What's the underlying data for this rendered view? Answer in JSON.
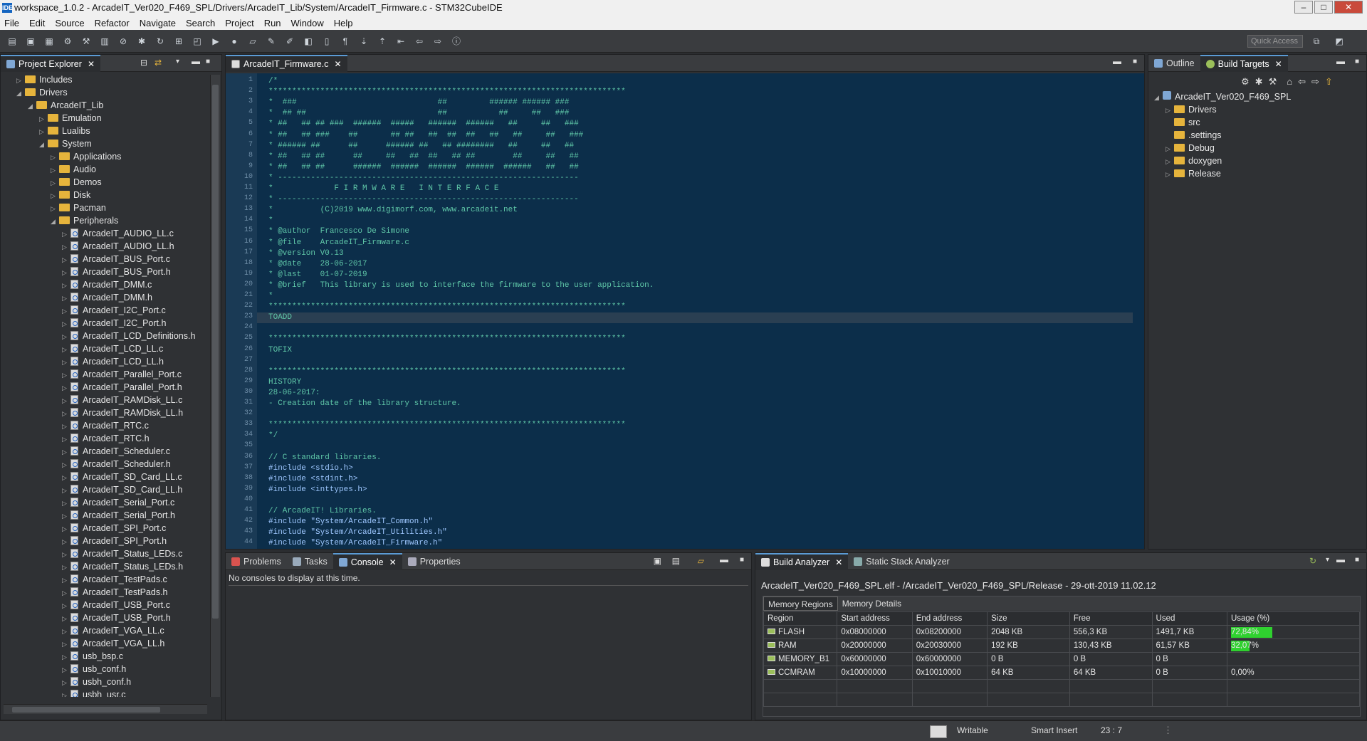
{
  "window": {
    "title": "workspace_1.0.2 - ArcadeIT_Ver020_F469_SPL/Drivers/ArcadeIT_Lib/System/ArcadeIT_Firmware.c - STM32CubeIDE",
    "logo": "IDE"
  },
  "menu": [
    "File",
    "Edit",
    "Source",
    "Refactor",
    "Navigate",
    "Search",
    "Project",
    "Run",
    "Window",
    "Help"
  ],
  "toolbar": {
    "quick_access_placeholder": "Quick Access"
  },
  "explorer": {
    "tab_label": "Project Explorer",
    "tree": [
      {
        "label": "Includes",
        "level": 1,
        "type": "folder",
        "arrow": "▷"
      },
      {
        "label": "Drivers",
        "level": 1,
        "type": "folder",
        "arrow": "◢"
      },
      {
        "label": "ArcadeIT_Lib",
        "level": 2,
        "type": "folder",
        "arrow": "◢"
      },
      {
        "label": "Emulation",
        "level": 3,
        "type": "folder",
        "arrow": "▷"
      },
      {
        "label": "Lualibs",
        "level": 3,
        "type": "folder",
        "arrow": "▷"
      },
      {
        "label": "System",
        "level": 3,
        "type": "folder",
        "arrow": "◢"
      },
      {
        "label": "Applications",
        "level": 4,
        "type": "folder",
        "arrow": "▷"
      },
      {
        "label": "Audio",
        "level": 4,
        "type": "folder",
        "arrow": "▷"
      },
      {
        "label": "Demos",
        "level": 4,
        "type": "folder",
        "arrow": "▷"
      },
      {
        "label": "Disk",
        "level": 4,
        "type": "folder",
        "arrow": "▷"
      },
      {
        "label": "Pacman",
        "level": 4,
        "type": "folder",
        "arrow": "▷"
      },
      {
        "label": "Peripherals",
        "level": 4,
        "type": "folder",
        "arrow": "◢"
      },
      {
        "label": "ArcadeIT_AUDIO_LL.c",
        "level": 5,
        "type": "file",
        "arrow": "▷"
      },
      {
        "label": "ArcadeIT_AUDIO_LL.h",
        "level": 5,
        "type": "file",
        "arrow": "▷"
      },
      {
        "label": "ArcadeIT_BUS_Port.c",
        "level": 5,
        "type": "file",
        "arrow": "▷"
      },
      {
        "label": "ArcadeIT_BUS_Port.h",
        "level": 5,
        "type": "file",
        "arrow": "▷"
      },
      {
        "label": "ArcadeIT_DMM.c",
        "level": 5,
        "type": "file",
        "arrow": "▷"
      },
      {
        "label": "ArcadeIT_DMM.h",
        "level": 5,
        "type": "file",
        "arrow": "▷"
      },
      {
        "label": "ArcadeIT_I2C_Port.c",
        "level": 5,
        "type": "file",
        "arrow": "▷"
      },
      {
        "label": "ArcadeIT_I2C_Port.h",
        "level": 5,
        "type": "file",
        "arrow": "▷"
      },
      {
        "label": "ArcadeIT_LCD_Definitions.h",
        "level": 5,
        "type": "file",
        "arrow": "▷"
      },
      {
        "label": "ArcadeIT_LCD_LL.c",
        "level": 5,
        "type": "file",
        "arrow": "▷"
      },
      {
        "label": "ArcadeIT_LCD_LL.h",
        "level": 5,
        "type": "file",
        "arrow": "▷"
      },
      {
        "label": "ArcadeIT_Parallel_Port.c",
        "level": 5,
        "type": "file",
        "arrow": "▷"
      },
      {
        "label": "ArcadeIT_Parallel_Port.h",
        "level": 5,
        "type": "file",
        "arrow": "▷"
      },
      {
        "label": "ArcadeIT_RAMDisk_LL.c",
        "level": 5,
        "type": "file",
        "arrow": "▷"
      },
      {
        "label": "ArcadeIT_RAMDisk_LL.h",
        "level": 5,
        "type": "file",
        "arrow": "▷"
      },
      {
        "label": "ArcadeIT_RTC.c",
        "level": 5,
        "type": "file",
        "arrow": "▷"
      },
      {
        "label": "ArcadeIT_RTC.h",
        "level": 5,
        "type": "file",
        "arrow": "▷"
      },
      {
        "label": "ArcadeIT_Scheduler.c",
        "level": 5,
        "type": "file",
        "arrow": "▷"
      },
      {
        "label": "ArcadeIT_Scheduler.h",
        "level": 5,
        "type": "file",
        "arrow": "▷"
      },
      {
        "label": "ArcadeIT_SD_Card_LL.c",
        "level": 5,
        "type": "file",
        "arrow": "▷"
      },
      {
        "label": "ArcadeIT_SD_Card_LL.h",
        "level": 5,
        "type": "file",
        "arrow": "▷"
      },
      {
        "label": "ArcadeIT_Serial_Port.c",
        "level": 5,
        "type": "file",
        "arrow": "▷"
      },
      {
        "label": "ArcadeIT_Serial_Port.h",
        "level": 5,
        "type": "file",
        "arrow": "▷"
      },
      {
        "label": "ArcadeIT_SPI_Port.c",
        "level": 5,
        "type": "file",
        "arrow": "▷"
      },
      {
        "label": "ArcadeIT_SPI_Port.h",
        "level": 5,
        "type": "file",
        "arrow": "▷"
      },
      {
        "label": "ArcadeIT_Status_LEDs.c",
        "level": 5,
        "type": "file",
        "arrow": "▷"
      },
      {
        "label": "ArcadeIT_Status_LEDs.h",
        "level": 5,
        "type": "file",
        "arrow": "▷"
      },
      {
        "label": "ArcadeIT_TestPads.c",
        "level": 5,
        "type": "file",
        "arrow": "▷"
      },
      {
        "label": "ArcadeIT_TestPads.h",
        "level": 5,
        "type": "file",
        "arrow": "▷"
      },
      {
        "label": "ArcadeIT_USB_Port.c",
        "level": 5,
        "type": "file",
        "arrow": "▷"
      },
      {
        "label": "ArcadeIT_USB_Port.h",
        "level": 5,
        "type": "file",
        "arrow": "▷"
      },
      {
        "label": "ArcadeIT_VGA_LL.c",
        "level": 5,
        "type": "file",
        "arrow": "▷"
      },
      {
        "label": "ArcadeIT_VGA_LL.h",
        "level": 5,
        "type": "file",
        "arrow": "▷"
      },
      {
        "label": "usb_bsp.c",
        "level": 5,
        "type": "file",
        "arrow": "▷"
      },
      {
        "label": "usb_conf.h",
        "level": 5,
        "type": "file",
        "arrow": "▷"
      },
      {
        "label": "usbh_conf.h",
        "level": 5,
        "type": "file",
        "arrow": "▷"
      },
      {
        "label": "usbh_usr.c",
        "level": 5,
        "type": "file",
        "arrow": "▷"
      }
    ]
  },
  "editor": {
    "tab_label": "ArcadeIT_Firmware.c",
    "current_line": 23,
    "lines": [
      {
        "n": "1",
        "t": "/*",
        "k": "cm"
      },
      {
        "n": "2",
        "t": "****************************************************************************",
        "k": "cm"
      },
      {
        "n": "3",
        "t": "*  ###                              ##         ###### ###### ###",
        "k": "cm"
      },
      {
        "n": "4",
        "t": "*  ## ##                            ##           ##     ##   ###",
        "k": "cm"
      },
      {
        "n": "5",
        "t": "* ##   ## ## ###  ######  #####   ######  ######   ##     ##   ###",
        "k": "cm"
      },
      {
        "n": "6",
        "t": "* ##   ## ###    ##       ## ##   ##  ##  ##   ##   ##     ##   ###",
        "k": "cm"
      },
      {
        "n": "7",
        "t": "* ###### ##      ##      ###### ##   ## ########   ##     ##   ##",
        "k": "cm"
      },
      {
        "n": "8",
        "t": "* ##   ## ##      ##     ##   ##  ##   ## ##        ##     ##   ##",
        "k": "cm"
      },
      {
        "n": "9",
        "t": "* ##   ## ##      ######  ######  ######  ######  ######   ##   ##",
        "k": "cm"
      },
      {
        "n": "10",
        "t": "* ----------------------------------------------------------------",
        "k": "cm"
      },
      {
        "n": "11",
        "t": "*             F I R M W A R E   I N T E R F A C E",
        "k": "cm"
      },
      {
        "n": "12",
        "t": "* ----------------------------------------------------------------",
        "k": "cm"
      },
      {
        "n": "13",
        "t": "*          (C)2019 www.digimorf.com, www.arcadeit.net",
        "k": "cm"
      },
      {
        "n": "14",
        "t": "*",
        "k": "cm"
      },
      {
        "n": "15",
        "t": "* @author  Francesco De Simone",
        "k": "cm"
      },
      {
        "n": "16",
        "t": "* @file    ArcadeIT_Firmware.c",
        "k": "cm"
      },
      {
        "n": "17",
        "t": "* @version V0.13",
        "k": "cm"
      },
      {
        "n": "18",
        "t": "* @date    28-06-2017",
        "k": "cm"
      },
      {
        "n": "19",
        "t": "* @last    01-07-2019",
        "k": "cm"
      },
      {
        "n": "20",
        "t": "* @brief   This library is used to interface the firmware to the user application.",
        "k": "cm"
      },
      {
        "n": "21",
        "t": "*",
        "k": "cm"
      },
      {
        "n": "22",
        "t": "****************************************************************************",
        "k": "cm"
      },
      {
        "n": "23",
        "t": "TOADD",
        "k": "cm"
      },
      {
        "n": "24",
        "t": "",
        "k": "cm"
      },
      {
        "n": "25",
        "t": "****************************************************************************",
        "k": "cm"
      },
      {
        "n": "26",
        "t": "TOFIX",
        "k": "cm"
      },
      {
        "n": "27",
        "t": "",
        "k": "cm"
      },
      {
        "n": "28",
        "t": "****************************************************************************",
        "k": "cm"
      },
      {
        "n": "29",
        "t": "HISTORY",
        "k": "cm"
      },
      {
        "n": "30",
        "t": "28-06-2017:",
        "k": "cm"
      },
      {
        "n": "31",
        "t": "- Creation date of the library structure.",
        "k": "cm"
      },
      {
        "n": "32",
        "t": "",
        "k": "cm"
      },
      {
        "n": "33",
        "t": "****************************************************************************",
        "k": "cm"
      },
      {
        "n": "34",
        "t": "*/",
        "k": "cm"
      },
      {
        "n": "35",
        "t": "",
        "k": "cm"
      },
      {
        "n": "36",
        "t": "// C standard libraries.",
        "k": "cm"
      },
      {
        "n": "37",
        "t": "#include <stdio.h>",
        "k": "inc"
      },
      {
        "n": "38",
        "t": "#include <stdint.h>",
        "k": "inc"
      },
      {
        "n": "39",
        "t": "#include <inttypes.h>",
        "k": "inc"
      },
      {
        "n": "40",
        "t": "",
        "k": "cm"
      },
      {
        "n": "41",
        "t": "// ArcadeIT! Libraries.",
        "k": "cm"
      },
      {
        "n": "42",
        "t": "#include \"System/ArcadeIT_Common.h\"",
        "k": "inc"
      },
      {
        "n": "43",
        "t": "#include \"System/ArcadeIT_Utilities.h\"",
        "k": "inc"
      },
      {
        "n": "44",
        "t": "#include \"System/ArcadeIT_Firmware.h\"",
        "k": "inc"
      }
    ]
  },
  "outline": {
    "tabs": [
      "Outline",
      "Build Targets"
    ],
    "tree": [
      {
        "label": "ArcadeIT_Ver020_F469_SPL",
        "level": 1,
        "arrow": "◢"
      },
      {
        "label": "Drivers",
        "level": 2,
        "arrow": "▷"
      },
      {
        "label": "src",
        "level": 2,
        "arrow": ""
      },
      {
        "label": ".settings",
        "level": 2,
        "arrow": ""
      },
      {
        "label": "Debug",
        "level": 2,
        "arrow": "▷"
      },
      {
        "label": "doxygen",
        "level": 2,
        "arrow": "▷"
      },
      {
        "label": "Release",
        "level": 2,
        "arrow": "▷"
      }
    ]
  },
  "console": {
    "tabs": [
      "Problems",
      "Tasks",
      "Console",
      "Properties"
    ],
    "message": "No consoles to display at this time."
  },
  "analyzer": {
    "tabs": [
      "Build Analyzer",
      "Static Stack Analyzer"
    ],
    "header": "ArcadeIT_Ver020_F469_SPL.elf - /ArcadeIT_Ver020_F469_SPL/Release - 29-ott-2019 11.02.12",
    "subtabs": [
      "Memory Regions",
      "Memory Details"
    ],
    "columns": [
      "Region",
      "Start address",
      "End address",
      "Size",
      "Free",
      "Used",
      "Usage (%)"
    ],
    "rows": [
      {
        "region": "FLASH",
        "start": "0x08000000",
        "end": "0x08200000",
        "size": "2048 KB",
        "free": "556,3 KB",
        "used": "1491,7 KB",
        "usage": "72,84%",
        "pct": 72.84
      },
      {
        "region": "RAM",
        "start": "0x20000000",
        "end": "0x20030000",
        "size": "192 KB",
        "free": "130,43 KB",
        "used": "61,57 KB",
        "usage": "32,07%",
        "pct": 32.07
      },
      {
        "region": "MEMORY_B1",
        "start": "0x60000000",
        "end": "0x60000000",
        "size": "0 B",
        "free": "0 B",
        "used": "0 B",
        "usage": "",
        "pct": 0
      },
      {
        "region": "CCMRAM",
        "start": "0x10000000",
        "end": "0x10010000",
        "size": "64 KB",
        "free": "64 KB",
        "used": "0 B",
        "usage": "0,00%",
        "pct": 0
      }
    ]
  },
  "status": {
    "writable": "Writable",
    "insert": "Smart Insert",
    "position": "23 : 7"
  },
  "colors": {
    "accent": "#5b9bd5",
    "usage_bar": "#2fd12f",
    "editor_bg": "#0c2e4a"
  }
}
